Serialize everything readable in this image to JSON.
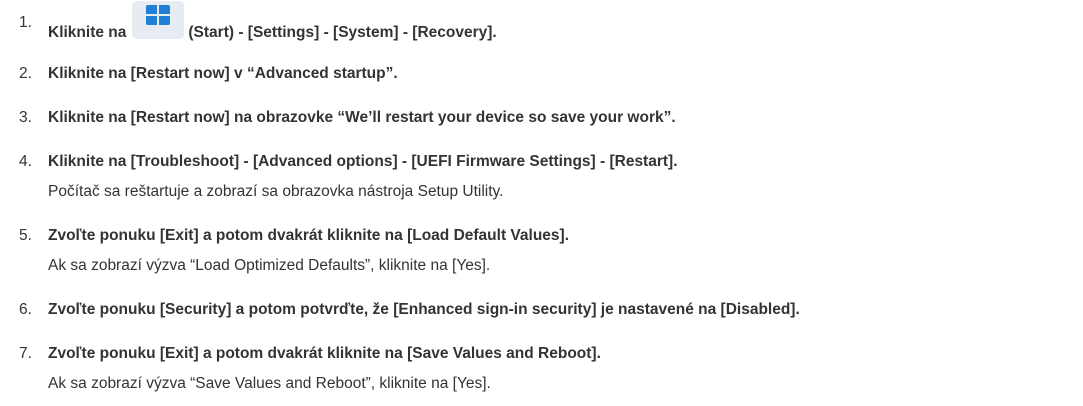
{
  "steps": [
    {
      "number": "1.",
      "before_icon": "Kliknite na",
      "icon": "windows-start-icon",
      "after_icon": "(Start) - [Settings] - [System] - [Recovery]."
    },
    {
      "number": "2.",
      "main": "Kliknite na [Restart now] v “Advanced startup”."
    },
    {
      "number": "3.",
      "main": "Kliknite na [Restart now] na obrazovke “We’ll restart your device so save your work”."
    },
    {
      "number": "4.",
      "main": "Kliknite na [Troubleshoot] - [Advanced options] - [UEFI Firmware Settings] - [Restart].",
      "note": "Počítač sa reštartuje a zobrazí sa obrazovka nástroja Setup Utility."
    },
    {
      "number": "5.",
      "main": "Zvoľte ponuku [Exit] a potom dvakrát kliknite na [Load Default Values].",
      "note": "Ak sa zobrazí výzva “Load Optimized Defaults”, kliknite na [Yes]."
    },
    {
      "number": "6.",
      "main": "Zvoľte ponuku [Security] a potom potvrďte, že [Enhanced sign-in security] je nastavené na [Disabled]."
    },
    {
      "number": "7.",
      "main": "Zvoľte ponuku [Exit] a potom dvakrát kliknite na [Save Values and Reboot].",
      "note": "Ak sa zobrazí výzva “Save Values and Reboot”, kliknite na [Yes]."
    }
  ],
  "colors": {
    "text": "#333333",
    "icon_blue": "#1f80d6",
    "icon_tile": "#e7ecf2"
  }
}
